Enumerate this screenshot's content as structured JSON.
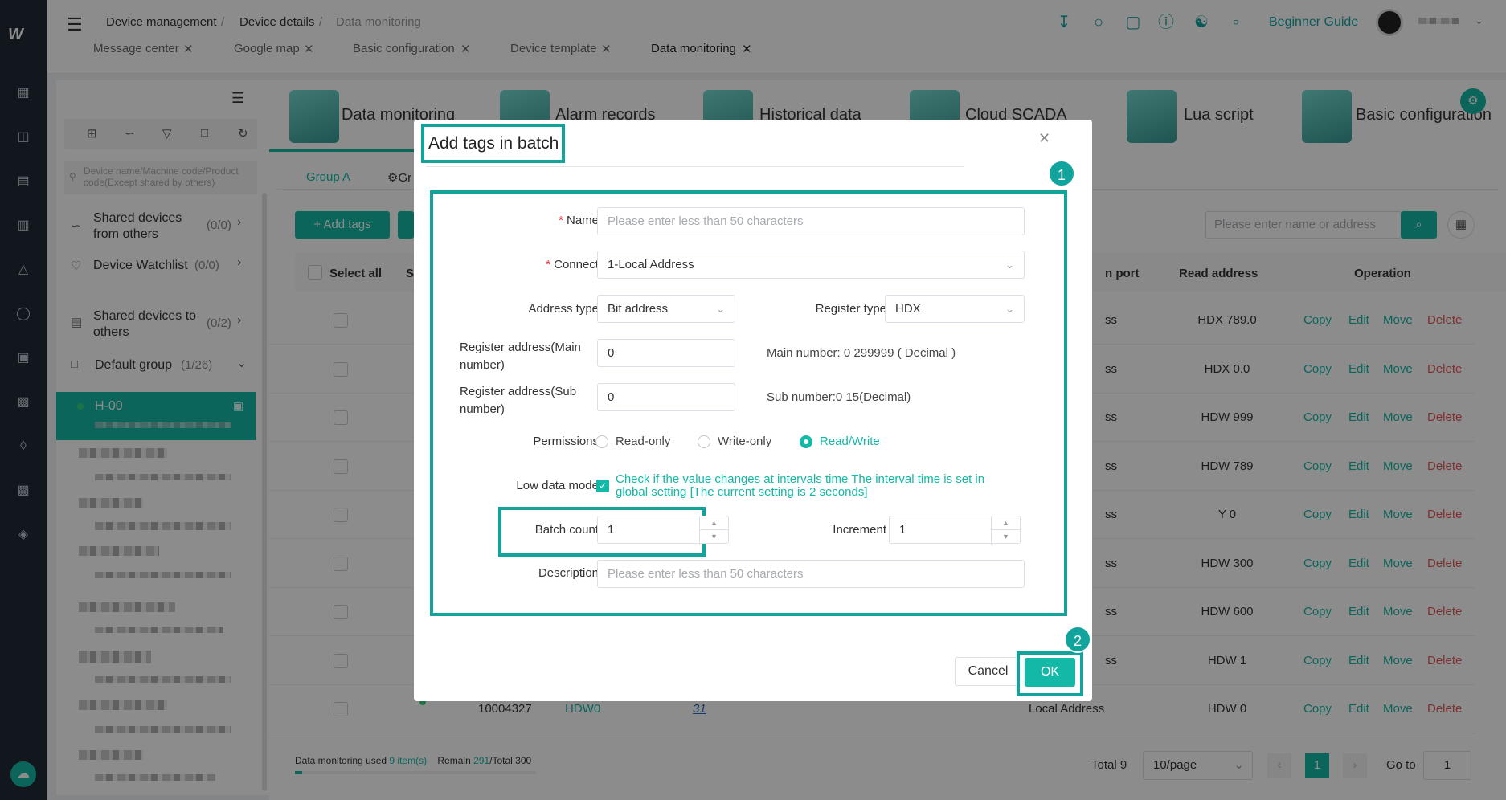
{
  "rail": {
    "logo": "W"
  },
  "header": {
    "breadcrumb": [
      "Device management",
      "Device details",
      "Data monitoring"
    ],
    "tabs": [
      "Message center",
      "Google map",
      "Basic configuration",
      "Device template",
      "Data monitoring"
    ],
    "beginner_guide": "Beginner Guide"
  },
  "sidebar": {
    "search_placeholder": "Device name/Machine code/Product code(Except shared by others)",
    "shared_from_label": "Shared devices from others",
    "shared_from_count": "(0/0)",
    "watchlist_label": "Device Watchlist",
    "watchlist_count": "(0/0)",
    "shared_to_label": "Shared devices to others",
    "shared_to_count": "(0/2)",
    "group_label": "Default group",
    "group_count": "(1/26)",
    "selected_device": "H-00"
  },
  "main": {
    "module_tabs": [
      "Data monitoring",
      "Alarm records",
      "Historical data",
      "Cloud SCADA",
      "Lua script",
      "Basic configuration"
    ],
    "sub_tabs": [
      "Group A",
      "Gr"
    ],
    "add_tags": "Add tags",
    "search_placeholder": "Please enter name or address",
    "columns": {
      "select_all": "Select all",
      "s": "S",
      "port": "n port",
      "read_address": "Read address",
      "operation": "Operation"
    },
    "rows": [
      {
        "port": "ss",
        "read": "HDX 789.0"
      },
      {
        "port": "ss",
        "read": "HDX 0.0"
      },
      {
        "port": "ss",
        "read": "HDW 999"
      },
      {
        "port": "ss",
        "read": "HDW 789"
      },
      {
        "port": "ss",
        "read": "Y 0"
      },
      {
        "port": "ss",
        "read": "HDW 300"
      },
      {
        "port": "ss",
        "read": "HDW 600"
      },
      {
        "port": "ss",
        "read": "HDW 1"
      },
      {
        "port": "Local Address",
        "read": "HDW 0",
        "id": "10004327",
        "name": "HDW0",
        "val": "31"
      }
    ],
    "ops": {
      "copy": "Copy",
      "edit": "Edit",
      "move": "Move",
      "delete": "Delete"
    },
    "footer": {
      "used_prefix": "Data monitoring used ",
      "used_value": "9 item(s)",
      "remain_prefix": "Remain ",
      "remain_value": "291",
      "total_suffix": "/Total 300",
      "total": "Total 9",
      "page_size": "10/page",
      "page": "1",
      "goto_label": "Go to",
      "goto_value": "1"
    }
  },
  "dialog": {
    "title": "Add tags in batch",
    "name_label": "Name",
    "name_placeholder": "Please enter less than 50 characters",
    "connect_label": "Connect",
    "connect_value": "1-Local Address",
    "address_type_label": "Address type",
    "address_type_value": "Bit address",
    "register_type_label": "Register type",
    "register_type_value": "HDX",
    "reg_main_label": "Register address(Main number)",
    "reg_main_value": "0",
    "reg_main_hint": "Main number: 0 299999 ( Decimal )",
    "reg_sub_label": "Register address(Sub number)",
    "reg_sub_value": "0",
    "reg_sub_hint": "Sub number:0 15(Decimal)",
    "permissions_label": "Permissions",
    "perm_options": [
      "Read-only",
      "Write-only",
      "Read/Write"
    ],
    "perm_selected": "Read/Write",
    "low_data_label": "Low data mode",
    "low_data_text": "Check if the value changes at intervals time The interval time is set in global setting [The current setting is 2 seconds]",
    "batch_count_label": "Batch count",
    "batch_count_value": "1",
    "increment_label": "Increment",
    "increment_value": "1",
    "description_label": "Description",
    "description_placeholder": "Please enter less than 50 characters",
    "cancel": "Cancel",
    "ok": "OK",
    "callouts": [
      "1",
      "2"
    ]
  },
  "colors": {
    "accent": "#14b8a6",
    "highlight": "#12a39d",
    "danger": "#e8575a",
    "rail": "#1f2b35"
  }
}
